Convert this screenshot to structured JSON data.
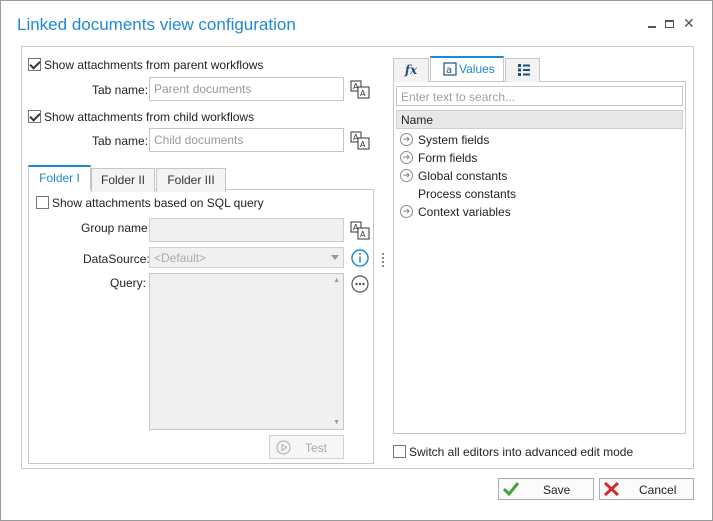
{
  "window": {
    "title": "Linked documents view configuration",
    "minimize_glyph": "",
    "maximize_glyph": "",
    "close_glyph": "✕"
  },
  "parent": {
    "checkbox_label": "Show attachments from parent workflows",
    "checked": true,
    "tab_name_label": "Tab name:",
    "tab_name_placeholder": "Parent documents"
  },
  "child": {
    "checkbox_label": "Show attachments from child workflows",
    "checked": true,
    "tab_name_label": "Tab name:",
    "tab_name_placeholder": "Child documents"
  },
  "folder_tabs": [
    "Folder I",
    "Folder II",
    "Folder III"
  ],
  "folder_panel": {
    "sql_checkbox_label": "Show attachments based on SQL query",
    "sql_checked": false,
    "group_name_label": "Group name:",
    "datasource_label": "DataSource:",
    "datasource_value": "<Default>",
    "query_label": "Query:",
    "test_button": "Test"
  },
  "right_panel": {
    "tabs": [
      {
        "name": "functions",
        "label": "fx"
      },
      {
        "name": "values",
        "label": "Values"
      },
      {
        "name": "list",
        "label": ""
      }
    ],
    "search_placeholder": "Enter text to search...",
    "column_header": "Name",
    "tree_items": [
      {
        "label": "System fields",
        "expandable": true
      },
      {
        "label": "Form fields",
        "expandable": true
      },
      {
        "label": "Global constants",
        "expandable": true
      },
      {
        "label": "Process constants",
        "expandable": false
      },
      {
        "label": "Context variables",
        "expandable": true
      }
    ]
  },
  "advanced_mode_label": "Switch all editors into advanced edit mode",
  "footer": {
    "save_label": "Save",
    "cancel_label": "Cancel"
  },
  "colors": {
    "accent": "#1e8ad6",
    "save_icon": "#3aa53a",
    "cancel_icon": "#d32f2f"
  }
}
